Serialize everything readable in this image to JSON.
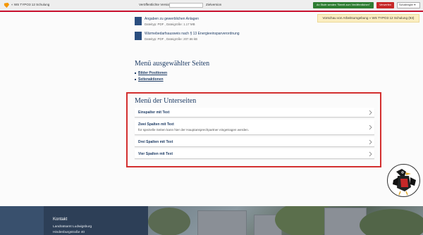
{
  "topbar": {
    "workspace_label": "WS TYPO3 12 Schulung",
    "published_version_label": "Veröffentlichte Version",
    "target_version_label": "Zielversion",
    "send_button": "An Stufe senden \"Bereit zum Veröffentlichen\"",
    "reject_button": "Verwerfen",
    "lang_select": "Schaltregler",
    "accent_color": "#c8102e"
  },
  "preview_banner": "Vorschau von Arbeitsumgebung » WS TYPO3 12 Schulung (93)",
  "downloads": [
    {
      "title": "Angaben zu gewerblichen Anlagen",
      "meta": "Dateityp: PDF , Dateigröße: 1.17 MB"
    },
    {
      "title": "Wärmebedarfsausweis nach § 13 Energieeinsparverordnung",
      "meta": "Dateityp: PDF , Dateigröße: 207.66 kB"
    }
  ],
  "selected_pages": {
    "heading": "Menü ausgewählter Seiten",
    "items": [
      "Bilder Positionen",
      "Seitenaktionen"
    ]
  },
  "subpages": {
    "heading": "Menü der Unterseiten",
    "items": [
      {
        "title": "Einspalter mit Text",
        "desc": ""
      },
      {
        "title": "Zwei Spalten mit Text",
        "desc": "für spezielle Seiten kann hier der Hauptansprechpartner eingetragen werden."
      },
      {
        "title": "Drei Spalten mit Text",
        "desc": ""
      },
      {
        "title": "Vier Spalten mit Text",
        "desc": ""
      }
    ]
  },
  "footer": {
    "heading": "Kontakt",
    "lines": [
      "Landratsamt Ludwigsburg",
      "Hindenburgstraße 40"
    ]
  }
}
